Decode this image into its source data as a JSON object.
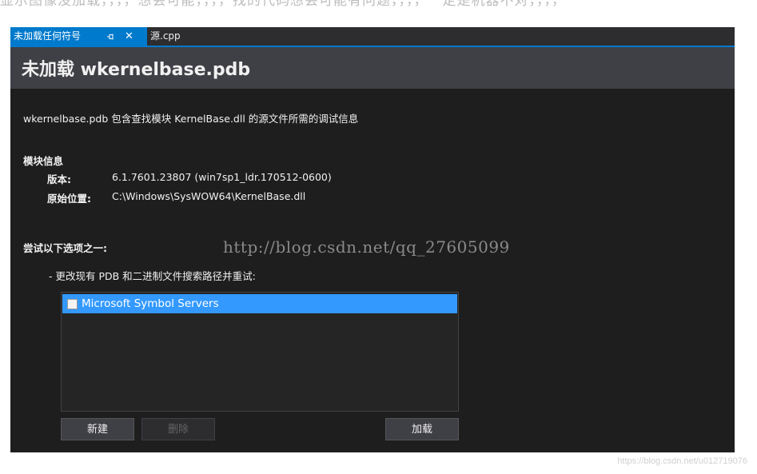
{
  "page_caption": "显示图像没加载，，，，想会可能，，，，找的代码想会可能有问题，，，，一定是机器不对，，，，",
  "tabs": [
    {
      "label": "未加载任何符号",
      "pin_icon": "pin-icon",
      "close_glyph": "✕"
    },
    {
      "label": "源.cpp"
    }
  ],
  "header": {
    "title": "未加载 wkernelbase.pdb"
  },
  "description": "wkernelbase.pdb 包含查找模块 KernelBase.dll 的源文件所需的调试信息",
  "module_info": {
    "title": "模块信息",
    "version_label": "版本:",
    "version_value": "6.1.7601.23807 (win7sp1_ldr.170512-0600)",
    "location_label": "原始位置:",
    "location_value": "C:\\Windows\\SysWOW64\\KernelBase.dll"
  },
  "options": {
    "title": "尝试以下选项之一:",
    "option_text": "- 更改现有 PDB 和二进制文件搜索路径并重试:",
    "list_items": [
      {
        "label": "Microsoft Symbol Servers",
        "checked": false,
        "selected": true
      }
    ]
  },
  "buttons": {
    "new": "新建",
    "delete": "删除",
    "load": "加载"
  },
  "watermarks": {
    "middle": "http://blog.csdn.net/qq_27605099",
    "bottom": "https://blog.csdn.net/u012719076"
  },
  "colors": {
    "accent": "#007acc",
    "selection": "#3399ff",
    "background": "#1e1e1e"
  }
}
